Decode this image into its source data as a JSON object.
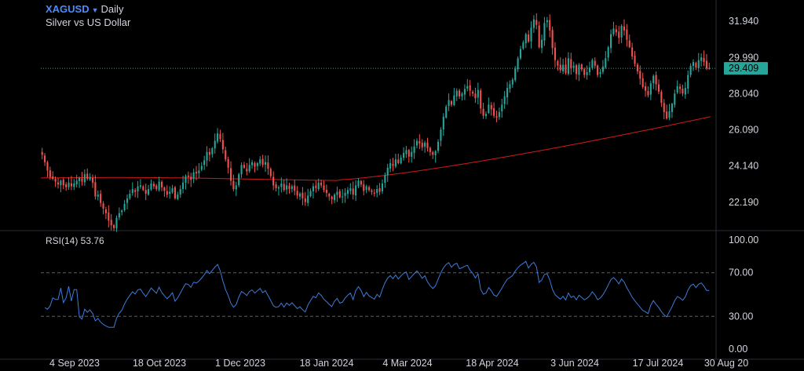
{
  "header": {
    "symbol": "XAGUSD",
    "interval": "Daily",
    "subtitle": "Silver vs US Dollar"
  },
  "rsi": {
    "label": "RSI(14) 53.76"
  },
  "colors": {
    "up": "#26a69a",
    "down": "#ef5350",
    "ma": "#d11a1a",
    "rsi": "#3d7bd9",
    "price_badge": "#26a69a",
    "accent": "#4a8cff"
  },
  "chart_data": [
    {
      "type": "candlestick",
      "title": "XAGUSD Daily",
      "price_axis_ticks": [
        "31.940",
        "29.990",
        "28.040",
        "26.090",
        "24.140",
        "22.190"
      ],
      "last_price": "29.409",
      "ylim": [
        21.0,
        32.5
      ],
      "x_tick_labels": [
        "4 Sep 2023",
        "18 Oct 2023",
        "1 Dec 2023",
        "18 Jan 2024",
        "4 Mar 2024",
        "18 Apr 2024",
        "3 Jun 2024",
        "17 Jul 2024",
        "30 Aug 20"
      ],
      "close": [
        24.75,
        24.35,
        23.9,
        23.55,
        23.45,
        23.3,
        23.15,
        23.35,
        23.1,
        23.0,
        23.25,
        23.05,
        23.2,
        23.35,
        23.5,
        23.3,
        23.7,
        23.45,
        23.55,
        23.25,
        22.5,
        22.6,
        22.15,
        21.85,
        21.6,
        21.2,
        20.95,
        20.8,
        21.35,
        21.6,
        21.75,
        22.1,
        22.4,
        22.65,
        22.9,
        22.75,
        23.05,
        23.1,
        22.85,
        22.65,
        22.9,
        23.2,
        23.05,
        22.9,
        23.3,
        23.0,
        22.8,
        22.6,
        22.75,
        22.95,
        22.4,
        22.6,
        22.9,
        23.25,
        23.6,
        23.55,
        23.4,
        23.8,
        23.75,
        23.9,
        24.15,
        24.45,
        24.9,
        24.75,
        25.1,
        25.5,
        25.9,
        25.6,
        25.05,
        24.5,
        24.05,
        23.35,
        22.9,
        23.1,
        23.7,
        24.2,
        24.05,
        23.85,
        24.2,
        24.35,
        24.1,
        24.3,
        24.5,
        24.2,
        24.35,
        24.0,
        23.6,
        23.1,
        22.95,
        23.0,
        23.2,
        22.85,
        23.1,
        22.9,
        23.05,
        22.8,
        22.55,
        22.65,
        22.4,
        22.2,
        22.55,
        22.8,
        23.05,
        22.95,
        23.25,
        23.1,
        22.85,
        22.7,
        22.5,
        22.35,
        22.6,
        22.75,
        22.45,
        22.5,
        22.7,
        22.85,
        22.95,
        22.6,
        23.1,
        23.35,
        23.15,
        22.8,
        23.05,
        22.85,
        22.75,
        22.65,
        22.9,
        22.75,
        23.2,
        23.65,
        24.05,
        24.3,
        24.15,
        24.5,
        24.3,
        24.6,
        24.85,
        25.0,
        24.65,
        24.9,
        25.2,
        25.5,
        25.35,
        25.15,
        25.4,
        25.1,
        24.9,
        24.75,
        24.95,
        25.45,
        26.1,
        26.8,
        27.35,
        27.7,
        27.45,
        27.95,
        28.2,
        27.9,
        28.05,
        28.3,
        28.45,
        28.2,
        28.05,
        27.8,
        28.25,
        27.25,
        26.85,
        26.95,
        27.45,
        27.2,
        26.85,
        26.75,
        27.05,
        27.45,
        27.9,
        28.35,
        28.55,
        28.8,
        29.4,
        29.95,
        30.45,
        30.8,
        31.25,
        30.85,
        31.6,
        32.05,
        31.75,
        30.55,
        30.95,
        31.85,
        32.0,
        31.45,
        30.5,
        29.85,
        29.55,
        29.3,
        29.6,
        29.15,
        29.95,
        29.4,
        29.55,
        29.1,
        29.6,
        29.35,
        29.05,
        29.2,
        29.45,
        29.85,
        29.55,
        29.05,
        29.2,
        29.5,
        29.95,
        30.55,
        31.25,
        31.55,
        31.35,
        31.05,
        31.7,
        31.45,
        30.95,
        30.55,
        30.05,
        29.65,
        29.25,
        28.85,
        28.4,
        28.2,
        27.95,
        28.6,
        29.0,
        28.55,
        28.15,
        27.55,
        27.05,
        26.7,
        27.1,
        27.5,
        28.05,
        28.45,
        28.3,
        28.05,
        28.35,
        29.05,
        29.55,
        29.75,
        29.45,
        29.85,
        30.0,
        29.75,
        29.4,
        29.409
      ],
      "series": [
        {
          "name": "MA",
          "kind": "moving_average",
          "start": 23.5,
          "end": 26.8
        }
      ]
    },
    {
      "type": "line",
      "title": "RSI(14) 53.76",
      "price_axis_ticks": [
        "100.00",
        "70.00",
        "30.00",
        "0.00"
      ],
      "ylim": [
        0,
        100
      ],
      "reference_lines": [
        70,
        30
      ],
      "last_value": 53.76
    }
  ]
}
